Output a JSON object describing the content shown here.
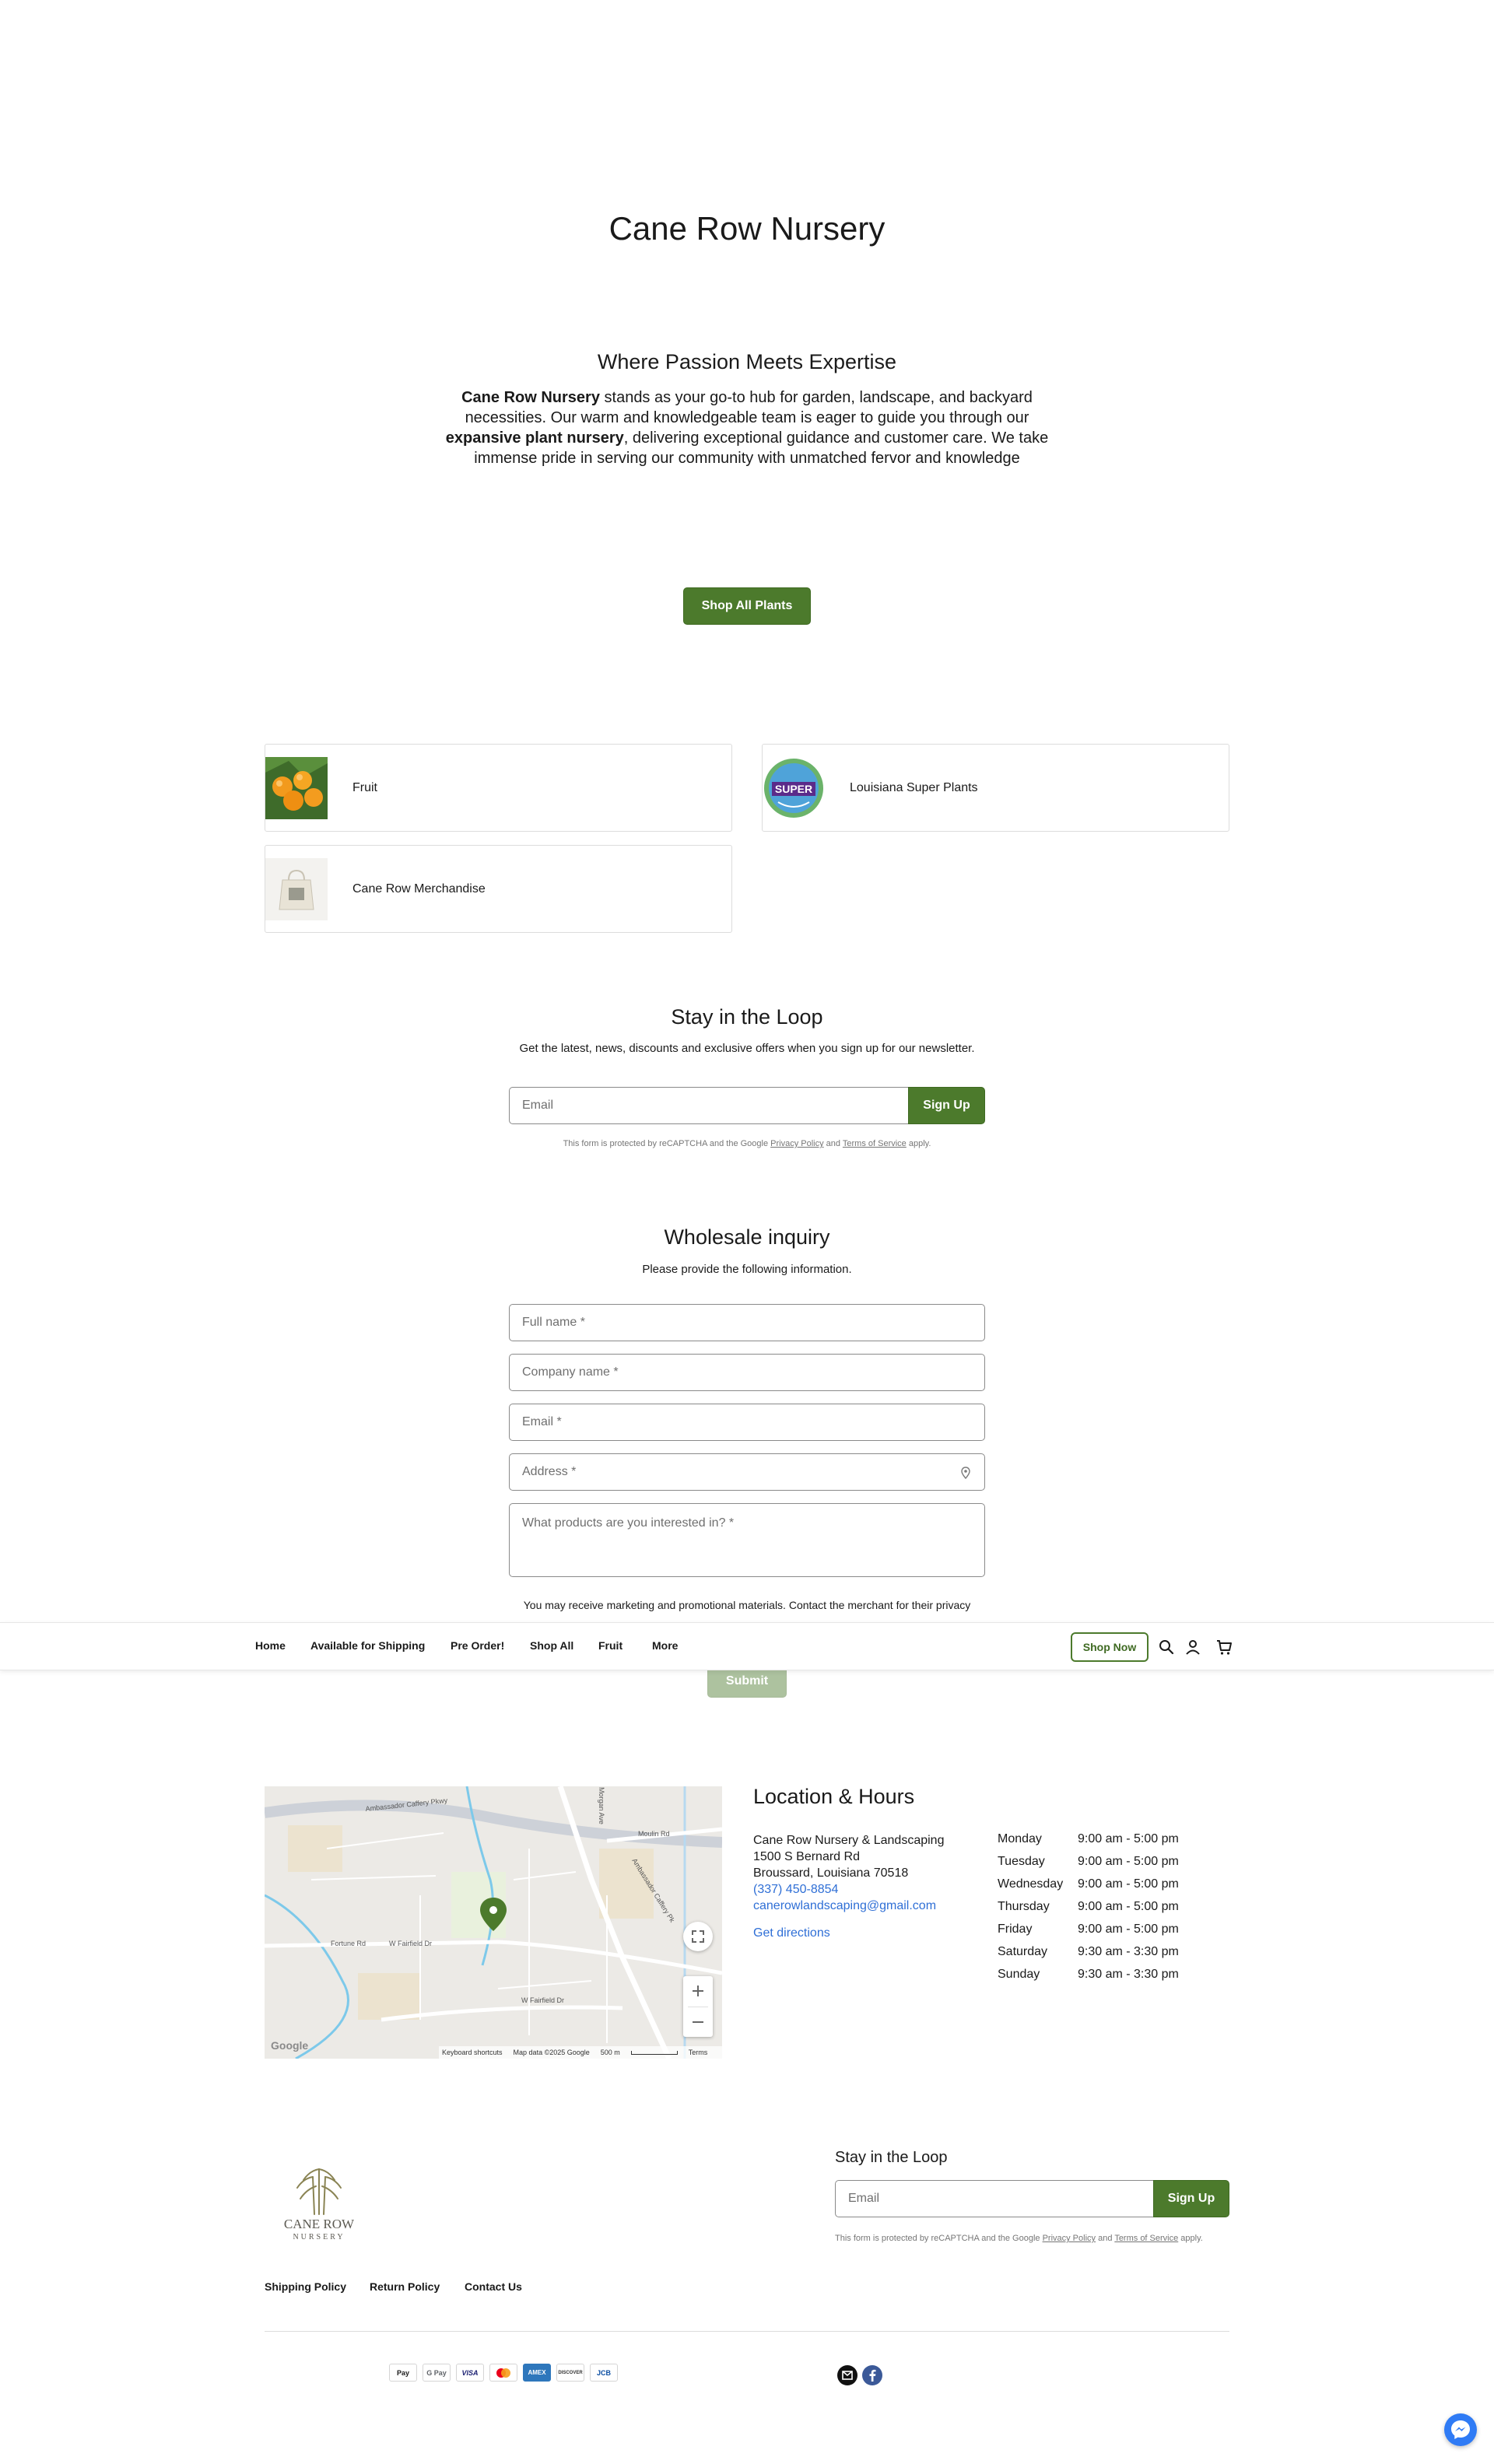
{
  "site": {
    "title": "Cane Row Nursery"
  },
  "hero": {
    "heading": "Where Passion Meets Expertise",
    "line1_bold": "Cane Row Nursery",
    "line1_rest": " stands as your go-to hub for garden, landscape, and backyard necessities. Our warm and knowledgeable team is eager to guide you through our ",
    "line2_bold": "expansive plant nursery",
    "line2_rest": ", delivering exceptional guidance and customer care. We take immense pride in serving our community with unmatched fervor and knowledge",
    "cta_label": "Shop All Plants"
  },
  "collections": [
    {
      "label": "Fruit"
    },
    {
      "label": "Louisiana Super Plants",
      "badge_text": "SUPER"
    },
    {
      "label": "Cane Row Merchandise"
    }
  ],
  "newsletter": {
    "heading": "Stay in the Loop",
    "subtext": "Get the latest, news, discounts and exclusive offers when you sign up for our newsletter.",
    "email_placeholder": "Email",
    "submit_label": "Sign Up",
    "recaptcha_prefix": "This form is protected by reCAPTCHA and the Google ",
    "privacy_label": "Privacy Policy",
    "and_label": " and ",
    "terms_label": "Terms of Service",
    "recaptcha_suffix": " apply."
  },
  "wholesale": {
    "heading": "Wholesale inquiry",
    "subtext": "Please provide the following information.",
    "fields": {
      "full_name": "Full name *",
      "company": "Company name *",
      "email": "Email *",
      "address": "Address *",
      "products": "What products are you interested in? *"
    },
    "disclaimer": "You may receive marketing and promotional materials. Contact the merchant for their privacy practices.",
    "submit_label": "Submit"
  },
  "nav": {
    "items": [
      "Home",
      "Available for Shipping",
      "Pre Order!",
      "Shop All",
      "Fruit",
      "More"
    ],
    "shop_now_label": "Shop Now",
    "icons": [
      "search-icon",
      "account-icon",
      "cart-icon"
    ]
  },
  "map": {
    "streets": {
      "ambassador": "Ambassador Caffery Pkwy",
      "morgan": "Morgan Ave",
      "moulin": "Moulin Rd",
      "ambassador_pk": "Ambassador Caffery Pk",
      "fortune": "Fortune Rd",
      "fairfield_dr": "W Fairfield Dr",
      "fairfield_dr2": "W Fairfield Dr"
    },
    "attribution": {
      "shortcuts": "Keyboard shortcuts",
      "data": "Map data ©2025 Google",
      "scale": "500 m",
      "terms": "Terms",
      "logo": "Google"
    },
    "marker_color": "#4c7a2c"
  },
  "location": {
    "heading": "Location & Hours",
    "name": "Cane Row Nursery & Landscaping",
    "street": "1500 S Bernard Rd",
    "city": "Broussard, Louisiana 70518",
    "phone": "(337) 450-8854",
    "email": "canerowlandscaping@gmail.com",
    "directions_label": "Get directions",
    "hours": [
      {
        "day": "Monday",
        "time": "9:00 am - 5:00 pm"
      },
      {
        "day": "Tuesday",
        "time": "9:00 am - 5:00 pm"
      },
      {
        "day": "Wednesday",
        "time": "9:00 am - 5:00 pm"
      },
      {
        "day": "Thursday",
        "time": "9:00 am - 5:00 pm"
      },
      {
        "day": "Friday",
        "time": "9:00 am - 5:00 pm"
      },
      {
        "day": "Saturday",
        "time": "9:30 am - 3:30 pm"
      },
      {
        "day": "Sunday",
        "time": "9:30 am - 3:30 pm"
      }
    ]
  },
  "footer": {
    "logo_line1": "CANE ROW",
    "logo_line2": "NURSERY",
    "links": [
      "Shipping Policy",
      "Return Policy",
      "Contact Us"
    ],
    "newsletter_heading": "Stay in the Loop",
    "email_placeholder": "Email",
    "submit_label": "Sign Up",
    "recaptcha_prefix": "This form is protected by reCAPTCHA and the Google ",
    "privacy_label": "Privacy Policy",
    "and_label": " and ",
    "terms_label": "Terms of Service",
    "recaptcha_suffix": " apply.",
    "payments": [
      "Pay",
      "G Pay",
      "VISA",
      "mastercard",
      "AMEX",
      "DISCOVER",
      "JCB"
    ]
  },
  "colors": {
    "brand_green": "#4c7a2c",
    "link_blue": "#2f6fd6",
    "messenger_blue": "#2f7bf5"
  }
}
